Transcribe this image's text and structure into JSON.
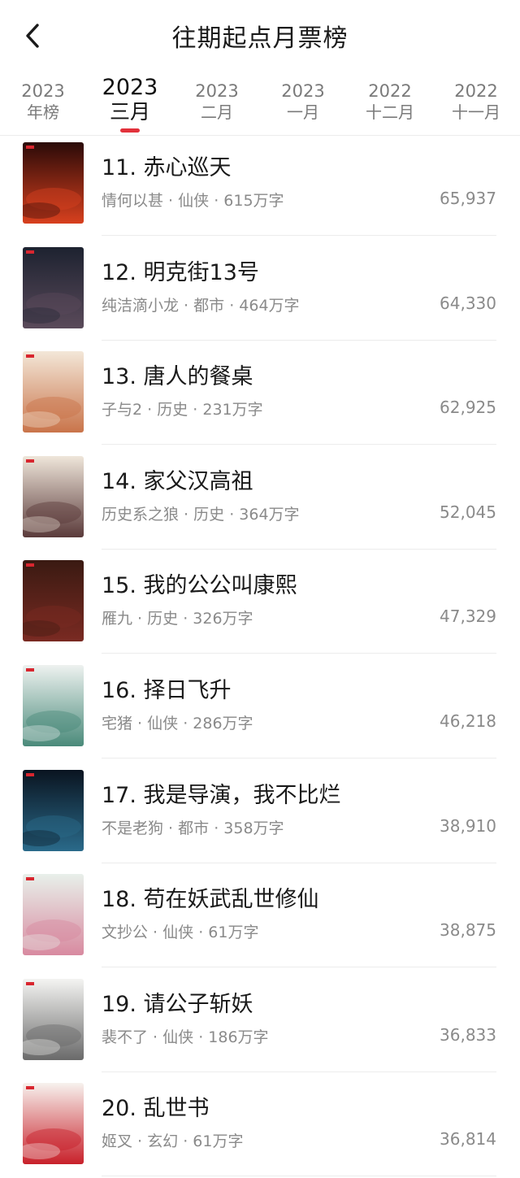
{
  "header": {
    "title": "往期起点月票榜",
    "back_icon": "chevron-left-icon"
  },
  "tabs": [
    {
      "year": "2023",
      "month": "年榜",
      "active": false
    },
    {
      "year": "2023",
      "month": "三月",
      "active": true
    },
    {
      "year": "2023",
      "month": "二月",
      "active": false
    },
    {
      "year": "2023",
      "month": "一月",
      "active": false
    },
    {
      "year": "2022",
      "month": "十二月",
      "active": false
    },
    {
      "year": "2022",
      "month": "十一月",
      "active": false
    }
  ],
  "accent_color": "#e2313b",
  "books": [
    {
      "rank_title": "11. 赤心巡天",
      "author": "情何以甚",
      "genre": "仙侠",
      "words": "615万字",
      "votes": "65,937",
      "cover_text": "赤心巡天",
      "cover_colors": [
        "#2a0a08",
        "#d8401e"
      ]
    },
    {
      "rank_title": "12. 明克街13号",
      "author": "纯洁滴小龙",
      "genre": "都市",
      "words": "464万字",
      "votes": "64,330",
      "cover_text": "明克街13号",
      "cover_colors": [
        "#1d2230",
        "#5a4a5a"
      ]
    },
    {
      "rank_title": "13. 唐人的餐桌",
      "author": "子与2",
      "genre": "历史",
      "words": "231万字",
      "votes": "62,925",
      "cover_text": "唐人的餐桌",
      "cover_colors": [
        "#f3e7d8",
        "#c9744a"
      ]
    },
    {
      "rank_title": "14. 家父汉高祖",
      "author": "历史系之狼",
      "genre": "历史",
      "words": "364万字",
      "votes": "52,045",
      "cover_text": "家父汉高祖",
      "cover_colors": [
        "#efe6da",
        "#5a3a3a"
      ]
    },
    {
      "rank_title": "15. 我的公公叫康熙",
      "author": "雁九",
      "genre": "历史",
      "words": "326万字",
      "votes": "47,329",
      "cover_text": "我的公公叫康熙",
      "cover_colors": [
        "#3a1a12",
        "#7a2a22"
      ]
    },
    {
      "rank_title": "16. 择日飞升",
      "author": "宅猪",
      "genre": "仙侠",
      "words": "286万字",
      "votes": "46,218",
      "cover_text": "择日飞升",
      "cover_colors": [
        "#eef2f0",
        "#4a8a7a"
      ]
    },
    {
      "rank_title": "17. 我是导演，我不比烂",
      "author": "不是老狗",
      "genre": "都市",
      "words": "358万字",
      "votes": "38,910",
      "cover_text": "我是导演，我不比烂",
      "cover_colors": [
        "#0a1420",
        "#2a6a8a"
      ]
    },
    {
      "rank_title": "18. 苟在妖武乱世修仙",
      "author": "文抄公",
      "genre": "仙侠",
      "words": "61万字",
      "votes": "38,875",
      "cover_text": "苟在妖武乱世修仙",
      "cover_colors": [
        "#e8f0ea",
        "#d88aa0"
      ]
    },
    {
      "rank_title": "19. 请公子斩妖",
      "author": "裴不了",
      "genre": "仙侠",
      "words": "186万字",
      "votes": "36,833",
      "cover_text": "请公子斩妖",
      "cover_colors": [
        "#f4f4f2",
        "#6a6a6a"
      ]
    },
    {
      "rank_title": "20. 乱世书",
      "author": "姬叉",
      "genre": "玄幻",
      "words": "61万字",
      "votes": "36,814",
      "cover_text": "乱世书",
      "cover_colors": [
        "#f7f2ee",
        "#c8202a"
      ]
    }
  ]
}
